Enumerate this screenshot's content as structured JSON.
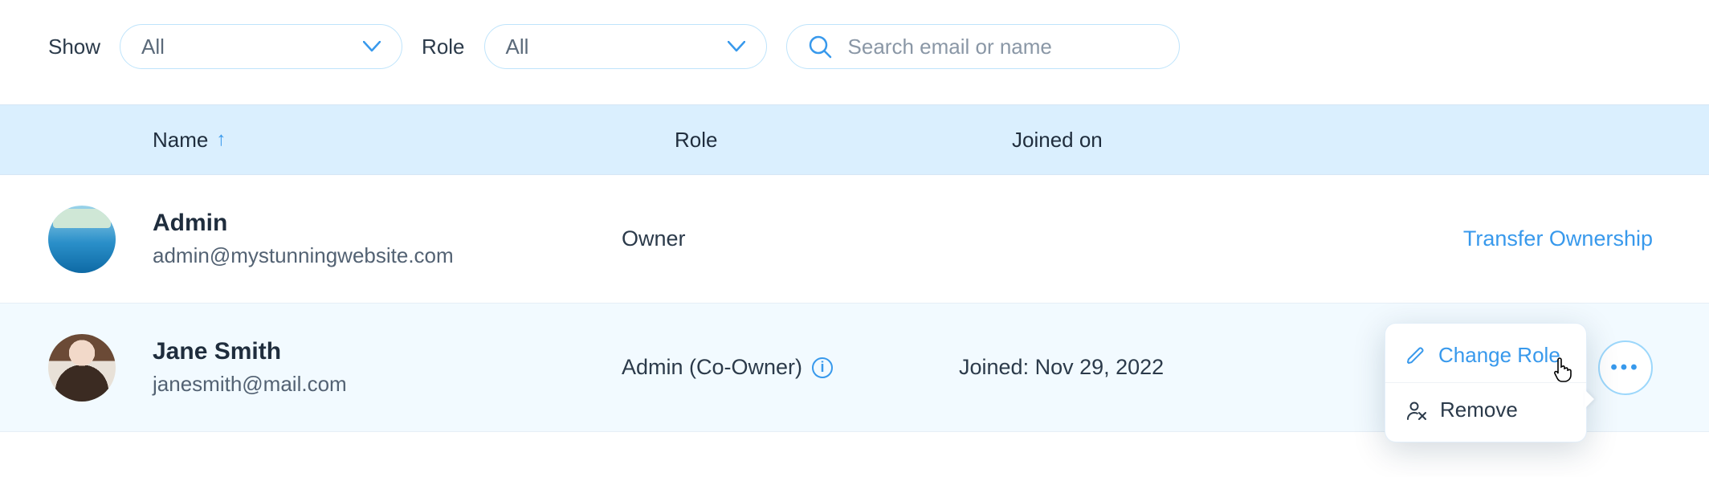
{
  "filters": {
    "show_label": "Show",
    "show_value": "All",
    "role_label": "Role",
    "role_value": "All",
    "search_placeholder": "Search email or name"
  },
  "columns": {
    "name": "Name",
    "role": "Role",
    "joined": "Joined on",
    "sort_asc_indicator": "↑"
  },
  "rows": [
    {
      "name": "Admin",
      "email": "admin@mystunningwebsite.com",
      "role": "Owner",
      "joined": "",
      "action": "Transfer Ownership"
    },
    {
      "name": "Jane Smith",
      "email": "janesmith@mail.com",
      "role": "Admin (Co-Owner)",
      "joined": "Joined: Nov 29, 2022",
      "info_tooltip_symbol": "i"
    }
  ],
  "popover": {
    "change_role": "Change Role",
    "remove": "Remove"
  },
  "colors": {
    "accent": "#3899ec",
    "header_bg": "#daeffe",
    "hover_row": "#f2faff"
  }
}
